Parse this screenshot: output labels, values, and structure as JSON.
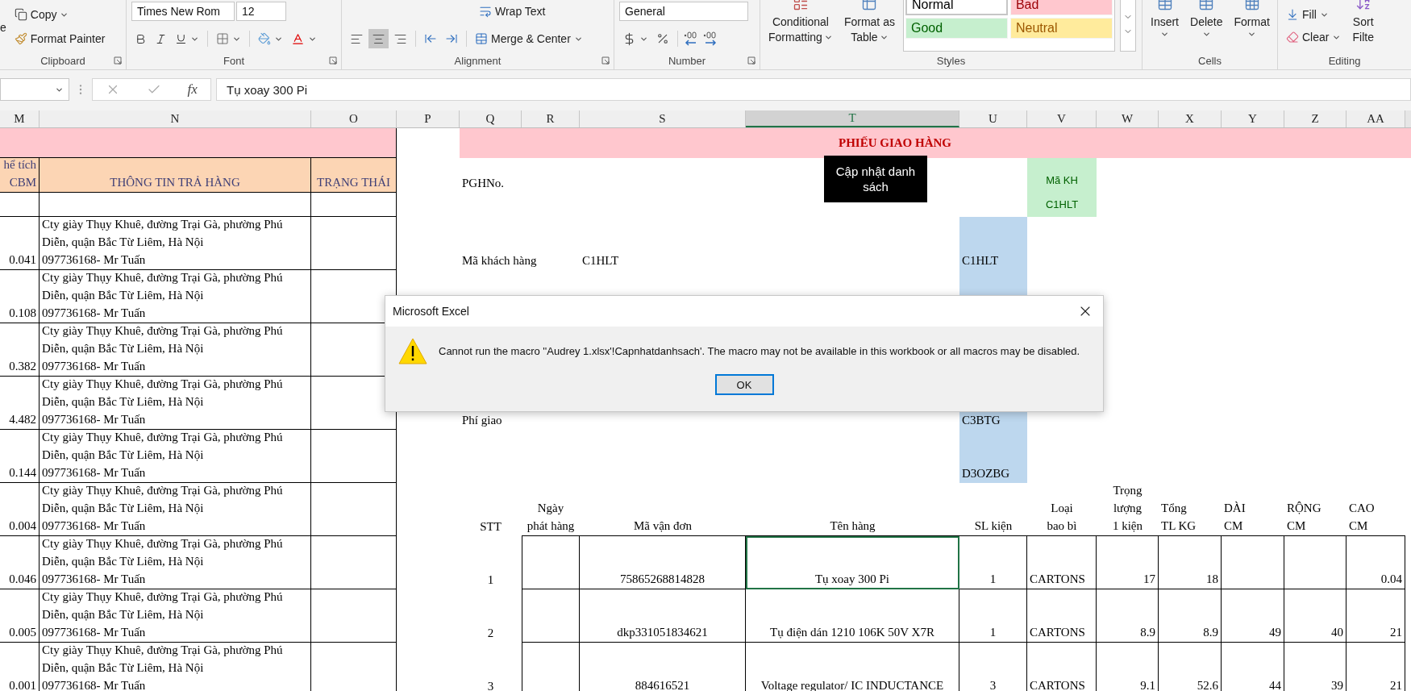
{
  "ribbon": {
    "clipboard": {
      "paste_label": "e",
      "copy": "Copy",
      "format_painter": "Format Painter",
      "label": "Clipboard"
    },
    "font": {
      "font_name": "Times New Rom",
      "font_size": "12",
      "label": "Font"
    },
    "alignment": {
      "wrap_text": "Wrap Text",
      "merge": "Merge & Center",
      "align_buttons": [
        {
          "selected": false
        },
        {
          "selected": true
        },
        {
          "selected": false
        }
      ],
      "label": "Alignment"
    },
    "number": {
      "format": "General",
      "label": "Number"
    },
    "styles": {
      "conditional": [
        "Conditional",
        "Formatting"
      ],
      "format_table": [
        "Format as",
        "Table"
      ],
      "cell_styles": [
        {
          "text": "Normal",
          "kind": "normal"
        },
        {
          "text": "Bad",
          "kind": "bad"
        },
        {
          "text": "Good",
          "kind": "good"
        },
        {
          "text": "Neutral",
          "kind": "neutral"
        }
      ],
      "label": "Styles"
    },
    "cells": {
      "buttons": [
        "Insert",
        "Delete",
        "Format"
      ],
      "label": "Cells"
    },
    "editing": {
      "fill": "Fill",
      "clear": "Clear",
      "sort": [
        "Sort",
        "Filte"
      ],
      "label": "Editing"
    }
  },
  "formula_bar": {
    "function_label": "fx",
    "value": "Tụ xoay 300 Pi"
  },
  "column_headers": [
    {
      "label": "M",
      "selected": false
    },
    {
      "label": "N",
      "selected": false
    },
    {
      "label": "O",
      "selected": false
    },
    {
      "label": "P",
      "selected": false
    },
    {
      "label": "Q",
      "selected": false
    },
    {
      "label": "R",
      "selected": false
    },
    {
      "label": "S",
      "selected": false
    },
    {
      "label": "T",
      "selected": true
    },
    {
      "label": "U",
      "selected": false
    },
    {
      "label": "V",
      "selected": false
    },
    {
      "label": "W",
      "selected": false
    },
    {
      "label": "X",
      "selected": false
    },
    {
      "label": "Y",
      "selected": false
    },
    {
      "label": "Z",
      "selected": false
    },
    {
      "label": "AA",
      "selected": false
    }
  ],
  "left_table": {
    "headers": [
      "hể tích\nCBM",
      "THÔNG TIN TRẢ HÀNG",
      "TRẠNG THÁI"
    ],
    "rows": [
      {
        "cbm": "0.041",
        "address": "Cty giày Thụy Khuê, đường Trại Gà, phường Phú\nDiễn, quận Bắc Từ Liêm, Hà Nội\n097736168- Mr Tuấn"
      },
      {
        "cbm": "0.108",
        "address": "Cty giày Thụy Khuê, đường Trại Gà, phường Phú\nDiễn, quận Bắc Từ Liêm, Hà Nội\n097736168- Mr Tuấn"
      },
      {
        "cbm": "0.382",
        "address": "Cty giày Thụy Khuê, đường Trại Gà, phường Phú\nDiễn, quận Bắc Từ Liêm, Hà Nội\n097736168- Mr Tuấn"
      },
      {
        "cbm": "4.482",
        "address": "Cty giày Thụy Khuê, đường Trại Gà, phường Phú\nDiễn, quận Bắc Từ Liêm, Hà Nội\n097736168- Mr Tuấn"
      },
      {
        "cbm": "0.144",
        "address": "Cty giày Thụy Khuê, đường Trại Gà, phường Phú\nDiễn, quận Bắc Từ Liêm, Hà Nội\n097736168- Mr Tuấn"
      },
      {
        "cbm": "0.004",
        "address": "Cty giày Thụy Khuê, đường Trại Gà, phường Phú\nDiễn, quận Bắc Từ Liêm, Hà Nội\n097736168- Mr Tuấn"
      },
      {
        "cbm": "0.046",
        "address": "Cty giày Thụy Khuê, đường Trại Gà, phường Phú\nDiễn, quận Bắc Từ Liêm, Hà Nội\n097736168- Mr Tuấn"
      },
      {
        "cbm": "0.005",
        "address": "Cty giày Thụy Khuê, đường Trại Gà, phường Phú\nDiễn, quận Bắc Từ Liêm, Hà Nội\n097736168- Mr Tuấn"
      },
      {
        "cbm": "0.001",
        "address": "Cty giày Thụy Khuê, đường Trại Gà, phường Phú\nDiễn, quận Bắc Từ Liêm, Hà Nội\n097736168- Mr Tuấn"
      }
    ]
  },
  "delivery_note": {
    "title": "PHIẾU GIAO HÀNG",
    "update_button": "Cập nhật danh sách",
    "note_no_label": "PGHNo.",
    "customer_tag": [
      "Mã KH",
      "C1HLT"
    ],
    "info_rows": [
      {
        "label": "Mã khách hàng",
        "value": "C1HLT",
        "code": "C1HLT"
      },
      {
        "label": "Phí giao",
        "code": "C3BTG"
      },
      {
        "code": "D3OZBG"
      }
    ],
    "table": {
      "headers": [
        "STT",
        "Ngày\nphát hàng",
        "Mã vận đơn",
        "Tên hàng",
        "SL kiện",
        "Loại\nbao bì",
        "Trọng\nlượng\n1 kiện",
        "Tổng\nTL KG",
        "DÀI\nCM",
        "RỘNG\nCM",
        "CAO\nCM"
      ],
      "rows": [
        {
          "cells": [
            {
              "text": "1",
              "selected": false
            },
            {
              "text": "",
              "selected": false
            },
            {
              "text": "75865268814828",
              "selected": false
            },
            {
              "text": "Tụ xoay 300 Pi",
              "selected": true
            },
            {
              "text": "1",
              "selected": false
            },
            {
              "text": "CARTONS",
              "selected": false
            },
            {
              "text": "17",
              "selected": false
            },
            {
              "text": "18",
              "selected": false
            },
            {
              "text": "",
              "selected": false
            },
            {
              "text": "",
              "selected": false
            },
            {
              "text": "0.04",
              "selected": false
            }
          ]
        },
        {
          "cells": [
            {
              "text": "2",
              "selected": false
            },
            {
              "text": "",
              "selected": false
            },
            {
              "text": "dkp331051834621",
              "selected": false
            },
            {
              "text": "Tụ điện dán 1210 106K 50V X7R",
              "selected": false
            },
            {
              "text": "1",
              "selected": false
            },
            {
              "text": "CARTONS",
              "selected": false
            },
            {
              "text": "8.9",
              "selected": false
            },
            {
              "text": "8.9",
              "selected": false
            },
            {
              "text": "49",
              "selected": false
            },
            {
              "text": "40",
              "selected": false
            },
            {
              "text": "21",
              "selected": false
            }
          ]
        },
        {
          "cells": [
            {
              "text": "3",
              "selected": false
            },
            {
              "text": "",
              "selected": false
            },
            {
              "text": "884616521",
              "selected": false
            },
            {
              "text": "Voltage regulator/ IC INDUCTANCE",
              "selected": false
            },
            {
              "text": "3",
              "selected": false
            },
            {
              "text": "CARTONS",
              "selected": false
            },
            {
              "text": "9.1",
              "selected": false
            },
            {
              "text": "52.6",
              "selected": false
            },
            {
              "text": "44",
              "selected": false
            },
            {
              "text": "39",
              "selected": false
            },
            {
              "text": "21",
              "selected": false
            }
          ]
        }
      ]
    }
  },
  "dialog": {
    "title": "Microsoft Excel",
    "message": "Cannot run the macro ''Audrey 1.xlsx'!Capnhatdanhsach'. The macro may not be available in this workbook or all macros may be disabled.",
    "button": "OK"
  }
}
